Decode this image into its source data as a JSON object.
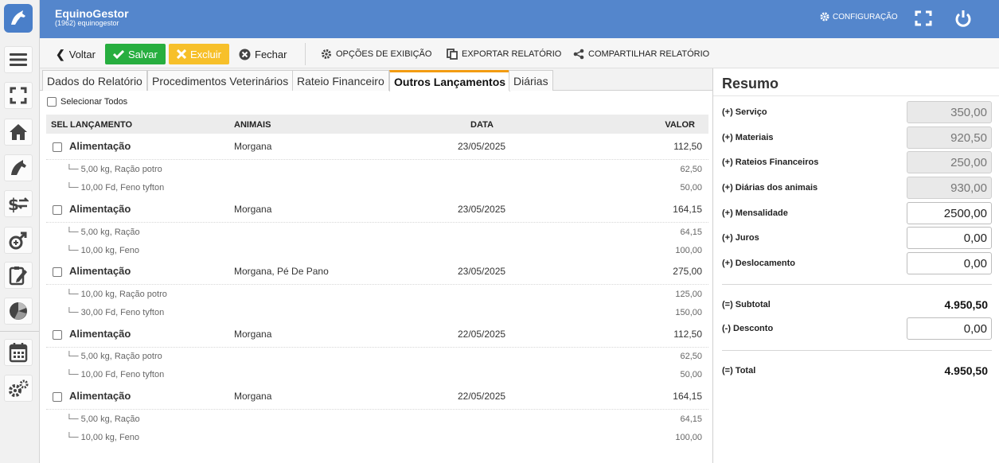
{
  "app": {
    "title": "EquinoGestor",
    "subtitle": "(1962) equinogestor",
    "config_label": "CONFIGURAÇÃO"
  },
  "toolbar": {
    "back_label": "Voltar",
    "save_label": "Salvar",
    "delete_label": "Excluir",
    "close_label": "Fechar",
    "display_options_label": "OPÇÕES DE EXIBIÇÃO",
    "export_label": "EXPORTAR RELATÓRIO",
    "share_label": "COMPARTILHAR RELATÓRIO"
  },
  "tabs": [
    "Dados do Relatório",
    "Procedimentos Veterinários",
    "Rateio Financeiro",
    "Outros Lançamentos",
    "Diárias"
  ],
  "active_tab": "Outros Lançamentos",
  "list": {
    "select_all_label": "Selecionar Todos",
    "columns": {
      "sel": "SEL",
      "lancamento": "LANÇAMENTO",
      "animais": "ANIMAIS",
      "data": "DATA",
      "valor": "VALOR"
    },
    "entries": [
      {
        "name": "Alimentação",
        "animals": "Morgana",
        "date": "23/05/2025",
        "value": "112,50",
        "items": [
          {
            "text": "└─ 5,00 kg, Ração potro",
            "value": "62,50"
          },
          {
            "text": "└─ 10,00 Fd, Feno tyfton",
            "value": "50,00"
          }
        ]
      },
      {
        "name": "Alimentação",
        "animals": "Morgana",
        "date": "23/05/2025",
        "value": "164,15",
        "items": [
          {
            "text": "└─ 5,00 kg, Ração",
            "value": "64,15"
          },
          {
            "text": "└─ 10,00 kg, Feno",
            "value": "100,00"
          }
        ]
      },
      {
        "name": "Alimentação",
        "animals": "Morgana, Pé De Pano",
        "date": "23/05/2025",
        "value": "275,00",
        "items": [
          {
            "text": "└─ 10,00 kg, Ração potro",
            "value": "125,00"
          },
          {
            "text": "└─ 30,00 Fd, Feno tyfton",
            "value": "150,00"
          }
        ]
      },
      {
        "name": "Alimentação",
        "animals": "Morgana",
        "date": "22/05/2025",
        "value": "112,50",
        "items": [
          {
            "text": "└─ 5,00 kg, Ração potro",
            "value": "62,50"
          },
          {
            "text": "└─ 10,00 Fd, Feno tyfton",
            "value": "50,00"
          }
        ]
      },
      {
        "name": "Alimentação",
        "animals": "Morgana",
        "date": "22/05/2025",
        "value": "164,15",
        "items": [
          {
            "text": "└─ 5,00 kg, Ração",
            "value": "64,15"
          },
          {
            "text": "└─ 10,00 kg, Feno",
            "value": "100,00"
          }
        ]
      }
    ]
  },
  "summary": {
    "title": "Resumo",
    "fields": [
      {
        "label": "(+) Serviço",
        "value": "350,00",
        "readonly": true
      },
      {
        "label": "(+) Materiais",
        "value": "920,50",
        "readonly": true
      },
      {
        "label": "(+) Rateios Financeiros",
        "value": "250,00",
        "readonly": true
      },
      {
        "label": "(+) Diárias dos animais",
        "value": "930,00",
        "readonly": true
      },
      {
        "label": "(+) Mensalidade",
        "value": "2500,00",
        "readonly": false
      },
      {
        "label": "(+) Juros",
        "value": "0,00",
        "readonly": false
      },
      {
        "label": "(+) Deslocamento",
        "value": "0,00",
        "readonly": false
      }
    ],
    "subtotal_label": "(=) Subtotal",
    "subtotal_value": "4.950,50",
    "discount_label": "(-) Desconto",
    "discount_value": "0,00",
    "total_label": "(=) Total",
    "total_value": "4.950,50"
  },
  "sidebar": {
    "icons": [
      "menu-icon",
      "expand-icon",
      "home-icon",
      "horse-icon",
      "finance-icon",
      "gender-icon",
      "report-edit-icon",
      "chart-pie-icon",
      "calendar-icon",
      "settings-icon"
    ]
  },
  "colors": {
    "header": "#5486cc",
    "save": "#27ae3f",
    "delete": "#f7c02a",
    "tab_accent": "#f39c12"
  }
}
